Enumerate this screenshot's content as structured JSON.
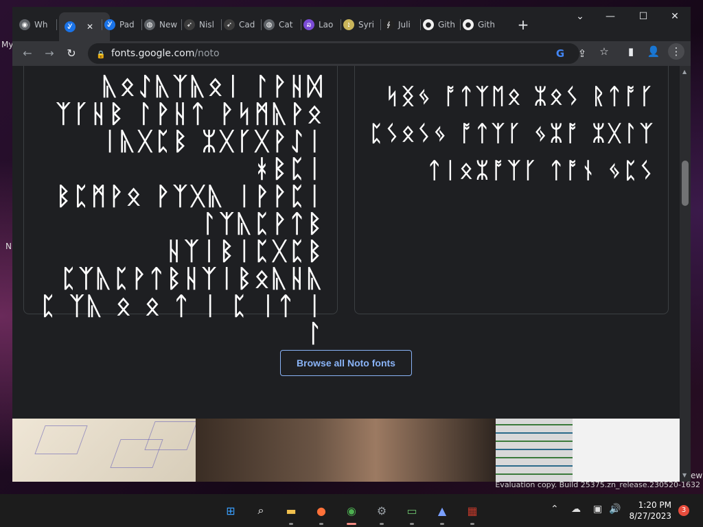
{
  "desktop": {
    "label_my": "My",
    "label_n": "N",
    "label_ew": "ew"
  },
  "tabs": [
    {
      "title": "Wh",
      "icon": "chrome-icon",
      "color": "#5f6368",
      "glyph": "◉"
    },
    {
      "title": "",
      "icon": "google-fonts-icon",
      "color": "#1a73e8",
      "glyph": "Ꮍ",
      "active": true,
      "close": "✕"
    },
    {
      "title": "Pad",
      "icon": "google-fonts-icon",
      "color": "#1a73e8",
      "glyph": "Ꮍ"
    },
    {
      "title": "New",
      "icon": "globe-icon",
      "color": "#5f6368",
      "glyph": "◍"
    },
    {
      "title": "Nisl",
      "icon": "astro-icon",
      "color": "#3c3c3c",
      "glyph": "➶"
    },
    {
      "title": "Cad",
      "icon": "astro-icon",
      "color": "#3c3c3c",
      "glyph": "➶"
    },
    {
      "title": "Cat",
      "icon": "globe-icon",
      "color": "#5f6368",
      "glyph": "◍"
    },
    {
      "title": "Lao",
      "icon": "noto-icon",
      "color": "#7b4bd6",
      "glyph": "ລ"
    },
    {
      "title": "Syri",
      "icon": "syriac-icon",
      "color": "#c9b45a",
      "glyph": "ܐ"
    },
    {
      "title": "Juli",
      "icon": "julia-icon",
      "color": "#222222",
      "glyph": "∮"
    },
    {
      "title": "Gith",
      "icon": "github-icon",
      "color": "#f0f0f0",
      "glyph": "●"
    },
    {
      "title": "Gith",
      "icon": "github-icon",
      "color": "#f0f0f0",
      "glyph": "●"
    }
  ],
  "newtab": "+",
  "window": {
    "tab_search": "⌄",
    "minimize": "—",
    "maximize": "☐",
    "close": "✕"
  },
  "toolbar": {
    "back": "←",
    "forward": "→",
    "reload": "↻",
    "lock": "🔒",
    "url_host": "fonts.google.com",
    "url_path": "/noto",
    "google": "G",
    "share": "⇪",
    "star": "☆",
    "sidepanel": "▮",
    "profile": "👤",
    "menu": "⋮"
  },
  "card_left": {
    "lines": [
      "ᚣᛟᛇᚣᛉᚣᛟᛁ ᛚᚹᚺᛞ",
      "ᛉᚴᚺᛒ ᛚᚹᚺᛏ ᚹᛋᛗᚣᚹᛟ",
      "ᛁᚣᚷᛈᛒ ᛯᚷᚴᚷᚹᛇᛁ ᚼᛒᛈᛁ",
      "ᛒᛈᛗᚹᛟ ᚹᛉᚷᚣ ᛁᚹᚹᛈᛁ",
      "ᛚᛉᚣᛈᚹᛏᛒ",
      "ᚺᛉᛁᛒᛁᛈᚷᛈᛒ",
      "ᛈᛉᚣᛈᚹᛏᛒᚺᛉᛁᛒᛟᚣᚺᚣ",
      "ᛈ ᛉᚣ ᛟ ᛟ ᛏ ᛁ ᛈ ᛁᛏ ᛁ ᛚ"
    ]
  },
  "card_right": {
    "lines": [
      "ᛋᛝᛃ ᚩᛏᛉᛖᛟ ᛯᛟᛊ ᚱᛏᚩᚴ",
      "ᛈᛊᛟᛊᛃ ᚩᛏᛉᚴ ᛃᛯᚩ ᛯᚷᛚᛉ",
      "ᛏᛁᛟᛯᚩᛉᚴ ᛏᚩᚾ ᛃᛈᛊ"
    ]
  },
  "browse_button": "Browse all Noto fonts",
  "scrollbar": {
    "up": "▲",
    "down": "▼"
  },
  "watermark": "Evaluation copy. Build 25375.zn_release.230520-1632",
  "taskbar": {
    "apps": [
      {
        "name": "start-icon",
        "glyph": "⊞",
        "color": "#3aa0ff"
      },
      {
        "name": "search-icon",
        "glyph": "⌕",
        "color": "#ffffff"
      },
      {
        "name": "file-explorer-icon",
        "glyph": "▬",
        "color": "#f2c14e"
      },
      {
        "name": "firefox-icon",
        "glyph": "●",
        "color": "#ff7139"
      },
      {
        "name": "chrome-icon",
        "glyph": "◉",
        "color": "#4caf50"
      },
      {
        "name": "settings-icon",
        "glyph": "⚙",
        "color": "#9aa0a6"
      },
      {
        "name": "battery-app-icon",
        "glyph": "▭",
        "color": "#6cbf6c"
      },
      {
        "name": "vector-app-icon",
        "glyph": "▲",
        "color": "#7aa0ff"
      },
      {
        "name": "archive-app-icon",
        "glyph": "▦",
        "color": "#c0392b"
      }
    ],
    "tray": {
      "chevron": "⌃",
      "cloud": "☁",
      "network": "▣",
      "volume": "🔊"
    },
    "time": "1:20 PM",
    "date": "8/27/2023",
    "notifications": "3"
  }
}
